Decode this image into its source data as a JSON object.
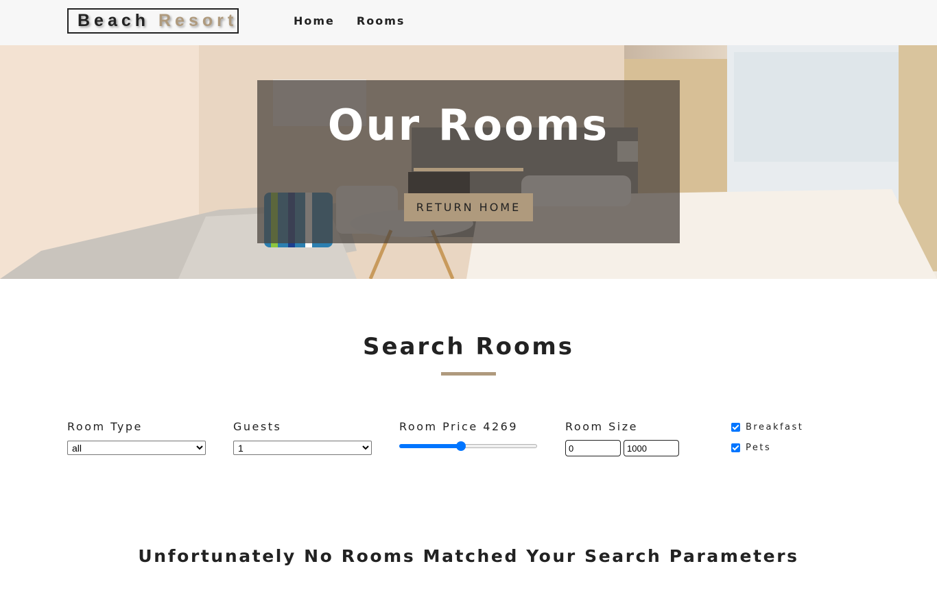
{
  "navbar": {
    "logo_word1": "Beach",
    "logo_word2": "Resort",
    "links": [
      "Home",
      "Rooms"
    ]
  },
  "hero": {
    "title": "Our Rooms",
    "button_label": "RETURN HOME"
  },
  "search": {
    "title": "Search Rooms",
    "room_type": {
      "label": "Room Type",
      "selected": "all"
    },
    "guests": {
      "label": "Guests",
      "selected": "1"
    },
    "price": {
      "label": "Room Price",
      "value": "4269",
      "fraction": 0.45
    },
    "size": {
      "label": "Room Size",
      "min": "0",
      "max": "1000"
    },
    "breakfast": {
      "label": "Breakfast",
      "checked": true
    },
    "pets": {
      "label": "Pets",
      "checked": true
    }
  },
  "empty_message": "Unfortunately No Rooms Matched Your Search Parameters",
  "colors": {
    "accent": "#af9a7d",
    "text": "#222222",
    "navbar_bg": "#f7f7f7",
    "slider": "#0075ff"
  }
}
